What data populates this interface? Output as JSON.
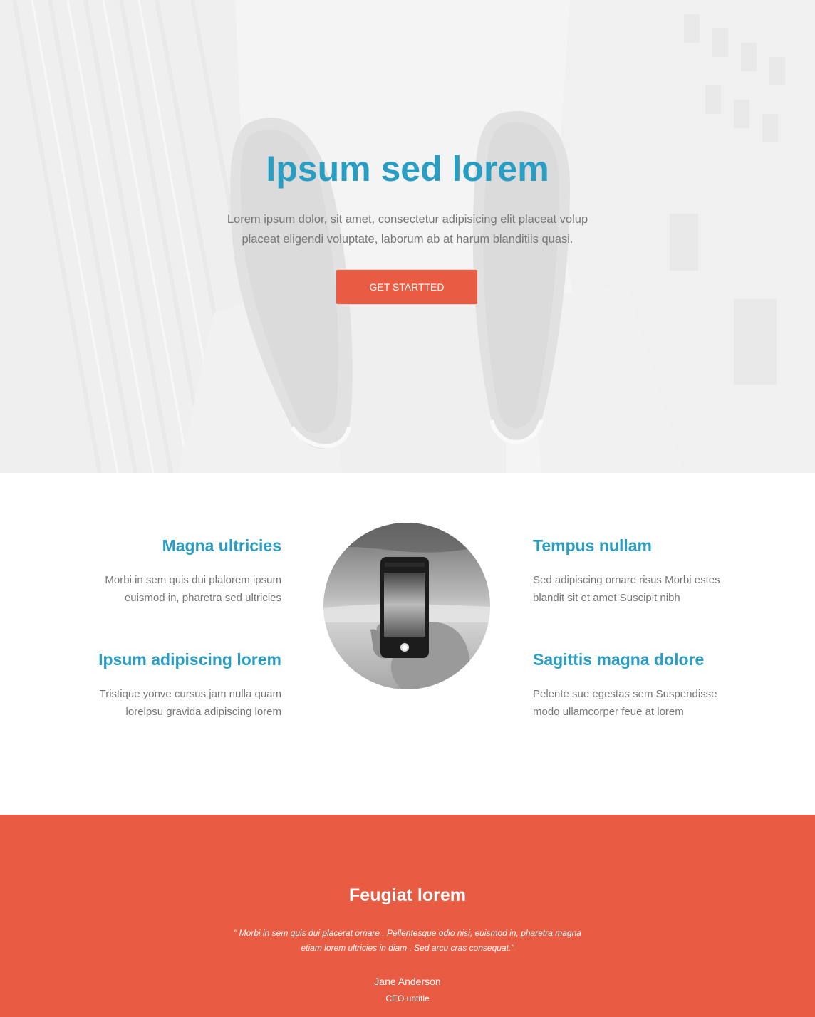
{
  "colors": {
    "accent_blue": "#2a9dc2",
    "accent_red": "#e85c44",
    "body_text": "#777777"
  },
  "hero": {
    "title": "Ipsum sed lorem",
    "text": "Lorem ipsum dolor, sit amet, consectetur adipisicing elit placeat volup placeat eligendi voluptate, laborum ab at harum blanditiis quasi.",
    "button_label": "GET STARTTED",
    "background_image": "feet-over-city-photo"
  },
  "features": {
    "items": [
      {
        "title": "Magna ultricies",
        "text": "Morbi in sem quis dui plalorem ipsum euismod in, pharetra sed ultricies"
      },
      {
        "title": "Ipsum adipiscing lorem",
        "text": "Tristique yonve cursus jam nulla quam lorelpsu gravida adipiscing lorem"
      },
      {
        "title": "Tempus nullam",
        "text": "Sed adipiscing ornare risus Morbi estes blandit sit et amet Suscipit nibh"
      },
      {
        "title": "Sagittis magna dolore",
        "text": "Pelente sue egestas sem Suspendisse modo ullamcorper feue at lorem"
      }
    ],
    "center_image": "hand-holding-phone-photo"
  },
  "testimonial": {
    "title": "Feugiat lorem",
    "quote": "\" Morbi in sem quis dui placerat ornare . Pellentesque odio nisi, euismod in, pharetra magna etiam lorem ultricies in diam . Sed arcu cras consequat.\"",
    "name": "Jane Anderson",
    "role": "CEO untitle"
  }
}
